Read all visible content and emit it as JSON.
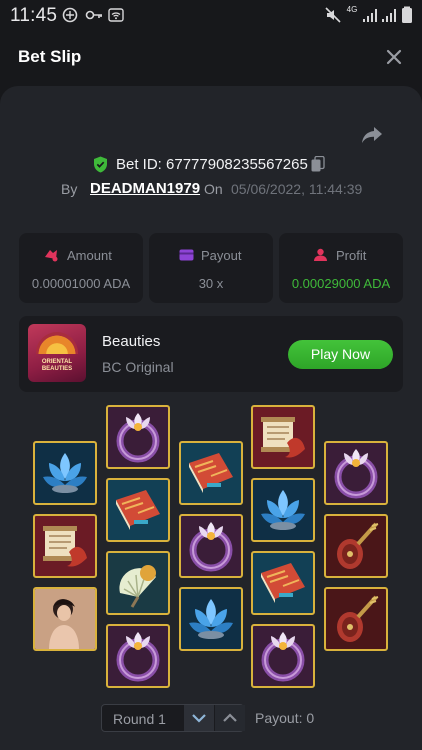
{
  "status_bar": {
    "time": "11:45",
    "network": "4G",
    "icons": [
      "data-saver-icon",
      "key-icon",
      "wifi-icon",
      "mute-icon",
      "signal-icon",
      "signal-icon",
      "battery-icon"
    ]
  },
  "header": {
    "title": "Bet Slip",
    "close_icon": "close-icon"
  },
  "bet": {
    "share_icon": "share-icon",
    "id_label": "Bet ID: 67777908235567265",
    "by_label": "By",
    "username": "DEADMAN1979",
    "on_label": "On",
    "date": "05/06/2022, 11:44:39"
  },
  "stats": {
    "amount": {
      "label": "Amount",
      "value": "0.00001000 ADA",
      "icon": "coins-icon"
    },
    "payout": {
      "label": "Payout",
      "value": "30 x",
      "icon": "wallet-icon"
    },
    "profit": {
      "label": "Profit",
      "value": "0.00029000 ADA",
      "icon": "user-profit-icon"
    }
  },
  "game": {
    "name": "Beauties",
    "provider": "BC Original",
    "thumbnail_text": "ORIENTAL BEAUTIES",
    "play_label": "Play Now"
  },
  "reels": [
    [
      "lotus-icon",
      "scroll-icon",
      "lady-icon"
    ],
    [
      "ring-icon",
      "book-icon",
      "fan-icon",
      "ring-icon"
    ],
    [
      "book-icon",
      "ring-icon",
      "lotus-icon"
    ],
    [
      "scroll-icon",
      "lotus-icon",
      "book-icon",
      "ring-icon"
    ],
    [
      "ring-icon",
      "pipa-icon",
      "pipa-icon"
    ]
  ],
  "footer": {
    "round_label": "Round 1",
    "payout_label": "Payout: 0"
  },
  "colors": {
    "accent_green": "#43c33a",
    "profit_green": "#3fb93a",
    "tile_border": "#d9b23c",
    "card_bg": "#222429",
    "panel_bg": "#1a1b1f"
  }
}
